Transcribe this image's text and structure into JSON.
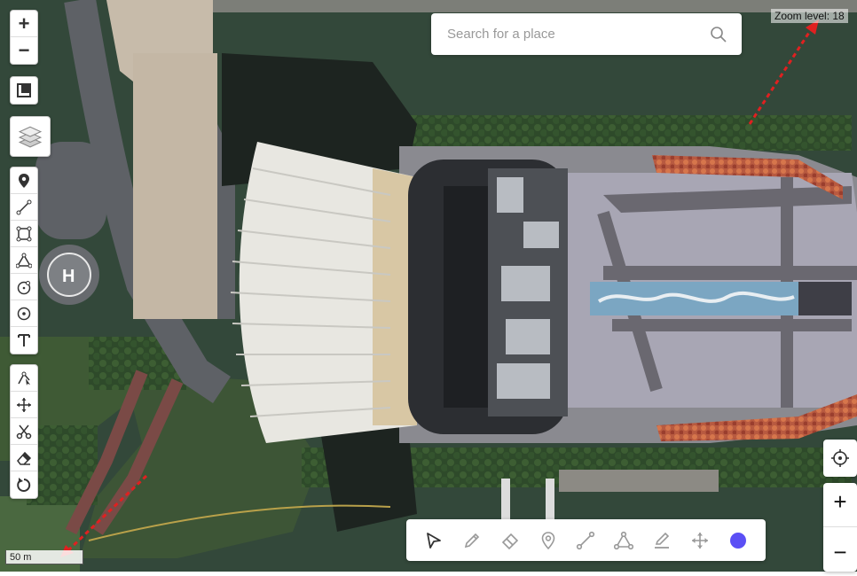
{
  "search": {
    "placeholder": "Search for a place"
  },
  "zoom": {
    "label": "Zoom level: 18"
  },
  "scale": {
    "label": "50 m"
  },
  "controls": {
    "zoom_in": "+",
    "zoom_out": "−",
    "right_zoom_in": "+",
    "right_zoom_out": "−"
  },
  "left_toolbar_icons": [
    "marker-icon",
    "polyline-icon",
    "rectangle-icon",
    "polygon-icon",
    "circle-icon",
    "circle-marker-icon",
    "text-icon",
    "edit-vertex-icon",
    "move-icon",
    "cut-icon",
    "eraser-icon",
    "rotate-icon"
  ],
  "bottom_toolbar_icons": [
    "pointer-icon",
    "pencil-icon",
    "eraser-icon",
    "marker-icon",
    "line-icon",
    "polygon-icon",
    "highlighter-icon",
    "move-icon",
    "color-swatch"
  ],
  "colors": {
    "accent": "#5b4ff5",
    "water": "#2f4a36",
    "annotation_arrow": "#e02020"
  }
}
